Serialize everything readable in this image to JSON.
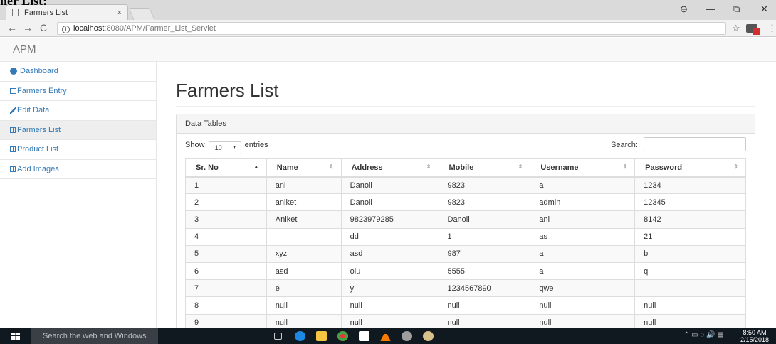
{
  "page_heading_clipped": "ner List:",
  "browser": {
    "tab_title": "Farmers List",
    "tab_close": "×",
    "url_host": "localhost",
    "url_path": ":8080/APM/Farmer_List_Servlet",
    "window_controls": [
      "⊖",
      "—",
      "⧉",
      "✕"
    ]
  },
  "app": {
    "brand": "APM"
  },
  "sidebar": {
    "items": [
      {
        "label": "Dashboard",
        "icon": "dashboard-icon"
      },
      {
        "label": "Farmers Entry",
        "icon": "edit-icon"
      },
      {
        "label": "Edit Data",
        "icon": "wrench-icon"
      },
      {
        "label": "Farmers List",
        "icon": "table-icon",
        "active": true
      },
      {
        "label": "Product List",
        "icon": "table-icon"
      },
      {
        "label": "Add Images",
        "icon": "table-icon"
      }
    ]
  },
  "main": {
    "title": "Farmers List",
    "panel_heading": "Data Tables",
    "show_label": "Show",
    "entries_value": "10",
    "entries_label": "entries",
    "search_label": "Search:",
    "table": {
      "columns": [
        "Sr. No",
        "Name",
        "Address",
        "Mobile",
        "Username",
        "Password"
      ],
      "rows": [
        [
          "1",
          "ani",
          "Danoli",
          "9823",
          "a",
          "1234"
        ],
        [
          "2",
          "aniket",
          "Danoli",
          "9823",
          "admin",
          "12345"
        ],
        [
          "3",
          "Aniket",
          "9823979285",
          "Danoli",
          "ani",
          "8142"
        ],
        [
          "4",
          "",
          "dd",
          "1",
          "as",
          "21"
        ],
        [
          "5",
          "xyz",
          "asd",
          "987",
          "a",
          "b"
        ],
        [
          "6",
          "asd",
          "oiu",
          "5555",
          "a",
          "q"
        ],
        [
          "7",
          "e",
          "y",
          "1234567890",
          "qwe",
          ""
        ],
        [
          "8",
          "null",
          "null",
          "null",
          "null",
          "null"
        ],
        [
          "9",
          "null",
          "null",
          "null",
          "null",
          "null"
        ]
      ]
    }
  },
  "taskbar": {
    "search_placeholder": "Search the web and Windows",
    "time": "8:50 AM",
    "date": "2/15/2018"
  },
  "colors": {
    "link": "#337ab7",
    "taskbar": "#101820"
  }
}
